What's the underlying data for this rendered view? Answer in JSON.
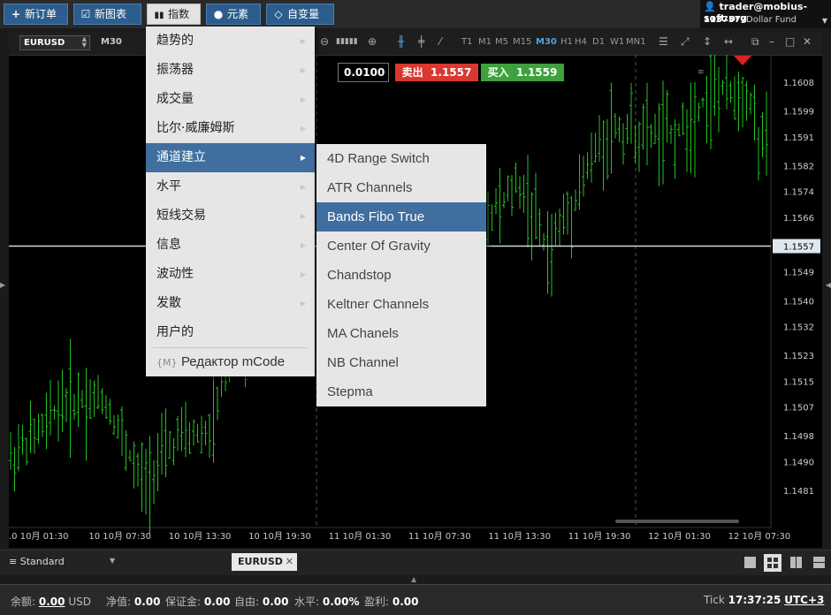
{
  "toolbar": {
    "new_order": "新订单",
    "new_chart": "新图表",
    "indicators": "指数",
    "elements": "元素",
    "variables": "自变量"
  },
  "account": {
    "email": "trader@mobius-soft.org",
    "number": "1137577",
    "name": "Dollar Fund"
  },
  "chart": {
    "symbol": "EURUSD",
    "timeframe": "M30",
    "timeframes": [
      "T1",
      "M1",
      "M5",
      "M15",
      "M30",
      "H1",
      "H4",
      "D1",
      "W1",
      "MN1"
    ],
    "lot": "0.0100",
    "sell_label": "卖出",
    "sell_price": "1.1557",
    "buy_label": "买入",
    "buy_price": "1.1559",
    "current_price": "1.1557",
    "price_ticks": [
      "1.1608",
      "1.1599",
      "1.1591",
      "1.1582",
      "1.1574",
      "1.1566",
      "1.1557",
      "1.1549",
      "1.1540",
      "1.1532",
      "1.1523",
      "1.1515",
      "1.1507",
      "1.1498",
      "1.1490",
      "1.1481"
    ],
    "time_ticks": [
      ".0 10月 01:30",
      "10 10月 07:30",
      "10 10月 13:30",
      "10 10月 19:30",
      "11 10月 01:30",
      "11 10月 07:30",
      "11 10月 13:30",
      "11 10月 19:30",
      "12 10月 01:30",
      "12 10月 07:30"
    ],
    "colors": {
      "up": "#22c322",
      "down": "#22c322",
      "price_line": "#cfd8dc",
      "marker": "#e02020"
    }
  },
  "main_menu": {
    "items": [
      {
        "label": "趋势的"
      },
      {
        "label": "振荡器"
      },
      {
        "label": "成交量"
      },
      {
        "label": "比尔·威廉姆斯"
      },
      {
        "label": "通道建立"
      },
      {
        "label": "水平"
      },
      {
        "label": "短线交易"
      },
      {
        "label": "信息"
      },
      {
        "label": "波动性"
      },
      {
        "label": "发散"
      },
      {
        "label": "用户的"
      }
    ],
    "editor_icon": "{M}",
    "editor_label": "Редактор mCode"
  },
  "sub_menu": {
    "items": [
      {
        "label": "4D Range Switch"
      },
      {
        "label": "ATR Channels"
      },
      {
        "label": "Bands Fibo True"
      },
      {
        "label": "Center Of Gravity"
      },
      {
        "label": "Chandstop"
      },
      {
        "label": "Keltner Channels"
      },
      {
        "label": "MA Chanels"
      },
      {
        "label": "NB Channel"
      },
      {
        "label": "Stepma"
      }
    ]
  },
  "tabs": {
    "layout": "Standard",
    "chart_tab": "EURUSD"
  },
  "status": {
    "balance_label": "余额:",
    "balance_value": "0.00",
    "balance_currency": "USD",
    "equity_label": "净值:",
    "equity_value": "0.00",
    "margin_label": "保证金:",
    "margin_value": "0.00",
    "free_label": "自由:",
    "free_value": "0.00",
    "level_label": "水平:",
    "level_value": "0.00%",
    "profit_label": "盈利:",
    "profit_value": "0.00",
    "tick_label": "Tick",
    "time": "17:37:25",
    "tz": "UTC+3"
  }
}
